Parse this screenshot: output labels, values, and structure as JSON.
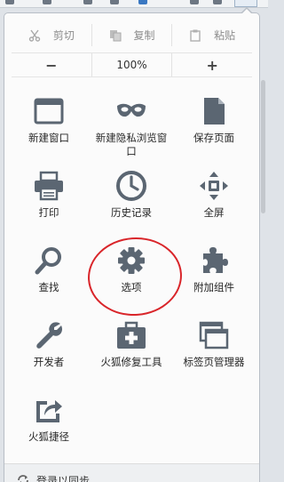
{
  "edit": {
    "cut": "剪切",
    "copy": "复制",
    "paste": "粘贴"
  },
  "zoom": {
    "minus": "−",
    "level": "100%",
    "plus": "+"
  },
  "items": [
    {
      "label": "新建窗口",
      "icon": "new-window-icon"
    },
    {
      "label": "新建隐私浏览窗口",
      "icon": "private-mask-icon"
    },
    {
      "label": "保存页面",
      "icon": "save-page-icon"
    },
    {
      "label": "打印",
      "icon": "print-icon"
    },
    {
      "label": "历史记录",
      "icon": "history-clock-icon"
    },
    {
      "label": "全屏",
      "icon": "fullscreen-icon"
    },
    {
      "label": "查找",
      "icon": "search-icon"
    },
    {
      "label": "选项",
      "icon": "gear-icon"
    },
    {
      "label": "附加组件",
      "icon": "puzzle-icon"
    },
    {
      "label": "开发者",
      "icon": "wrench-icon"
    },
    {
      "label": "火狐修复工具",
      "icon": "toolbox-icon"
    },
    {
      "label": "标签页管理器",
      "icon": "tab-manager-icon"
    },
    {
      "label": "火狐捷径",
      "icon": "share-shortcut-icon"
    }
  ],
  "footer": {
    "sync_label": "登录以同步"
  },
  "colors": {
    "icon": "#5b6672",
    "annotation": "#d9252a"
  }
}
